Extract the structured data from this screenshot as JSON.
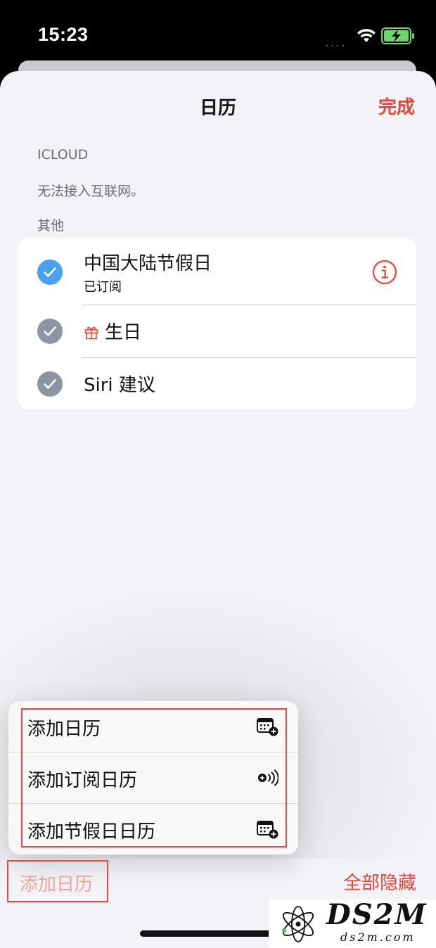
{
  "status_bar": {
    "time": "15:23",
    "signal": "....",
    "icons": [
      "wifi-icon",
      "battery-charging-icon"
    ]
  },
  "header": {
    "title": "日历",
    "done_label": "完成"
  },
  "icloud_section": {
    "header": "ICLOUD",
    "note": "无法接入互联网。"
  },
  "other_section": {
    "header": "其他",
    "items": [
      {
        "title": "中国大陆节假日",
        "subtitle": "已订阅",
        "checked": true,
        "check_color": "#4a9ff0",
        "icon": "info-icon"
      },
      {
        "title": "生日",
        "checked": true,
        "check_color": "#8d95a3",
        "icon": "gift-icon"
      },
      {
        "title": "Siri 建议",
        "checked": true,
        "check_color": "#8d95a3"
      }
    ]
  },
  "popup_menu": {
    "items": [
      {
        "label": "添加日历",
        "icon": "calendar-add-icon"
      },
      {
        "label": "添加订阅日历",
        "icon": "subscribe-broadcast-icon"
      },
      {
        "label": "添加节假日日历",
        "icon": "calendar-add-icon"
      }
    ]
  },
  "toolbar": {
    "add_calendar_label": "添加日历",
    "hide_all_label": "全部隐藏"
  },
  "watermark": {
    "brand": "DS2M",
    "domain": "ds2m.com"
  },
  "colors": {
    "accent": "#e1483b",
    "background": "#f2f2f7",
    "highlight_box": "#ee4444"
  }
}
